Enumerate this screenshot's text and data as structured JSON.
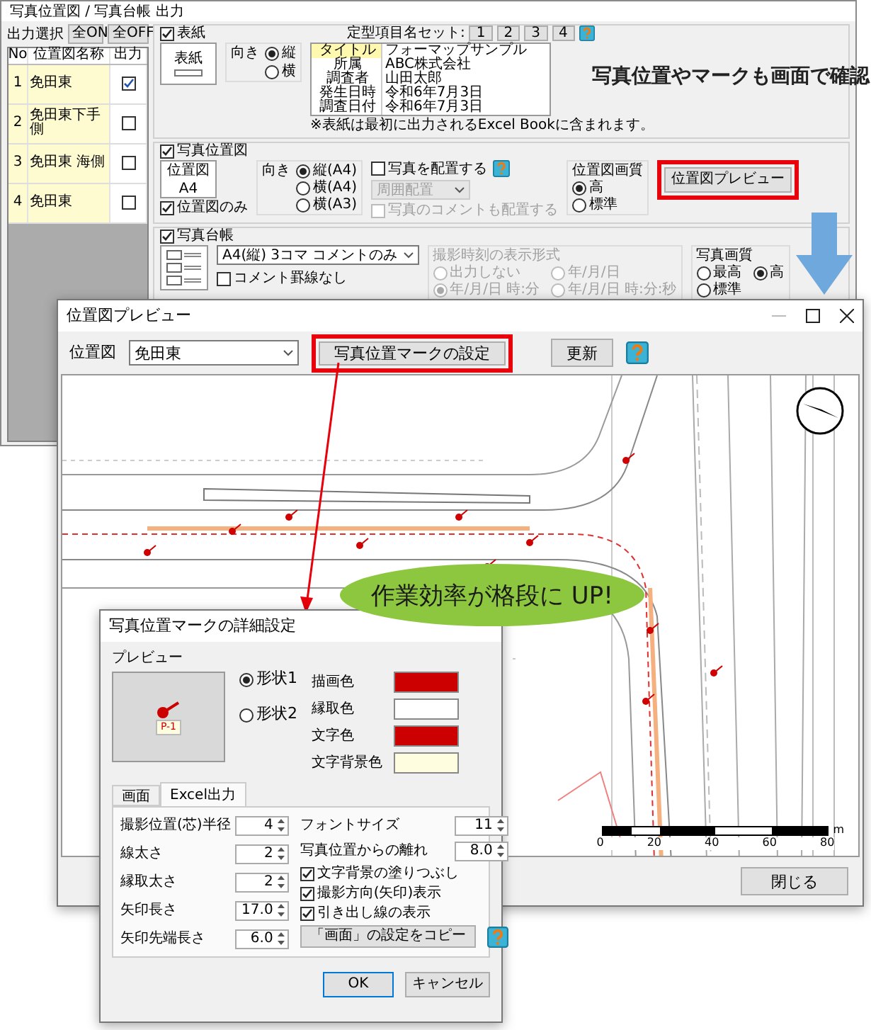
{
  "setup_window": {
    "title": "写真位置図 / 写真台帳 出力",
    "output_label": "出力選択",
    "toggle_buttons": [
      "全ON",
      "全OFF"
    ],
    "map_list": {
      "columns": [
        "No",
        "位置図名称",
        "出力"
      ],
      "rows": [
        {
          "no": "1",
          "name": "免田東",
          "checked": true
        },
        {
          "no": "2",
          "name": "免田東下手側",
          "checked": false
        },
        {
          "no": "3",
          "name": "免田東 海側",
          "checked": false
        },
        {
          "no": "4",
          "name": "免田東",
          "checked": false
        }
      ]
    },
    "cover": {
      "label": "表紙",
      "checked": true,
      "thumbnail_label": "表紙",
      "orientation": {
        "label": "向き",
        "options": [
          {
            "label": "縦",
            "selected": true
          },
          {
            "label": "横",
            "selected": false
          }
        ]
      },
      "preset_label": "定型項目名セット:",
      "preset_buttons": [
        "1",
        "2",
        "3",
        "4"
      ],
      "fields": [
        {
          "name": "タイトル",
          "value": "フォーマップサンプル",
          "selected": true
        },
        {
          "name": "所属",
          "value": "ABC株式会社",
          "selected": false
        },
        {
          "name": "調査者",
          "value": "山田太郎",
          "selected": false
        },
        {
          "name": "発生日時",
          "value": "令和6年7月3日",
          "selected": false
        },
        {
          "name": "調査日付",
          "value": "令和6年7月3日",
          "selected": false
        }
      ],
      "note": "※表紙は最初に出力されるExcel Bookに含まれます。"
    },
    "position_map": {
      "label": "写真位置図",
      "checked": true,
      "thumbnail_labels": [
        "位置図",
        "A4"
      ],
      "map_only": {
        "label": "位置図のみ",
        "checked": true
      },
      "orientation": {
        "label": "向き",
        "options": [
          {
            "label": "縦(A4)",
            "selected": true
          },
          {
            "label": "横(A4)",
            "selected": false
          },
          {
            "label": "横(A3)",
            "selected": false
          }
        ]
      },
      "place_photos": {
        "label": "写真を配置する",
        "checked": false
      },
      "placement": {
        "value": "周囲配置",
        "disabled": true
      },
      "place_comments": {
        "label": "写真のコメントも配置する",
        "checked": false,
        "disabled": true
      },
      "quality": {
        "label": "位置図画質",
        "options": [
          {
            "label": "高",
            "selected": true
          },
          {
            "label": "標準",
            "selected": false
          }
        ]
      },
      "preview_button": "位置図プレビュー"
    },
    "photo_ledger": {
      "label": "写真台帳",
      "checked": true,
      "layout": "A4(縦) 3コマ コメントのみ",
      "no_comment_lines": {
        "label": "コメント罫線なし",
        "checked": false
      },
      "time_format": {
        "label": "撮影時刻の表示形式",
        "disabled": true,
        "options": [
          {
            "label": "出力しない",
            "selected": false
          },
          {
            "label": "年/月/日",
            "selected": false
          },
          {
            "label": "年/月/日 時:分",
            "selected": true
          },
          {
            "label": "年/月/日 時:分:秒",
            "selected": false
          }
        ]
      },
      "quality": {
        "label": "写真画質",
        "options": [
          {
            "label": "最高",
            "selected": false
          },
          {
            "label": "高",
            "selected": true
          },
          {
            "label": "標準",
            "selected": false
          }
        ]
      }
    }
  },
  "callout": "写真位置やマークも画面で確認",
  "preview_window": {
    "title": "位置図プレビュー",
    "map_label": "位置図",
    "map_select": "免田東",
    "mark_settings_button": "写真位置マークの設定",
    "refresh_button": "更新",
    "scale": {
      "ticks": [
        "0",
        "20",
        "40",
        "60",
        "80"
      ],
      "unit": "m"
    },
    "close_button": "閉じる"
  },
  "badge": "作業効率が格段に UP!",
  "mark_dialog": {
    "title": "写真位置マークの詳細設定",
    "preview_label": "プレビュー",
    "marker_label": "P-1",
    "shapes": [
      {
        "label": "形状1",
        "selected": true
      },
      {
        "label": "形状2",
        "selected": false
      }
    ],
    "colors": [
      {
        "label": "描画色",
        "color": "#cc0000"
      },
      {
        "label": "縁取色",
        "color": "#ffffff"
      },
      {
        "label": "文字色",
        "color": "#cc0000"
      },
      {
        "label": "文字背景色",
        "color": "#fffde0"
      }
    ],
    "tabs": [
      {
        "label": "画面",
        "selected": false
      },
      {
        "label": "Excel出力",
        "selected": true
      }
    ],
    "left_fields": [
      {
        "label": "撮影位置(芯)半径",
        "value": "4"
      },
      {
        "label": "線太さ",
        "value": "2"
      },
      {
        "label": "縁取太さ",
        "value": "2"
      },
      {
        "label": "矢印長さ",
        "value": "17.0"
      },
      {
        "label": "矢印先端長さ",
        "value": "6.0"
      }
    ],
    "right_fields": [
      {
        "label": "フォントサイズ",
        "value": "11"
      },
      {
        "label": "写真位置からの離れ",
        "value": "8.0"
      }
    ],
    "options": [
      {
        "label": "文字背景の塗りつぶし",
        "checked": true
      },
      {
        "label": "撮影方向(矢印)表示",
        "checked": true
      },
      {
        "label": "引き出し線の表示",
        "checked": true
      }
    ],
    "copy_button": "「画面」の設定をコピー",
    "buttons": [
      "OK",
      "キャンセル"
    ]
  }
}
